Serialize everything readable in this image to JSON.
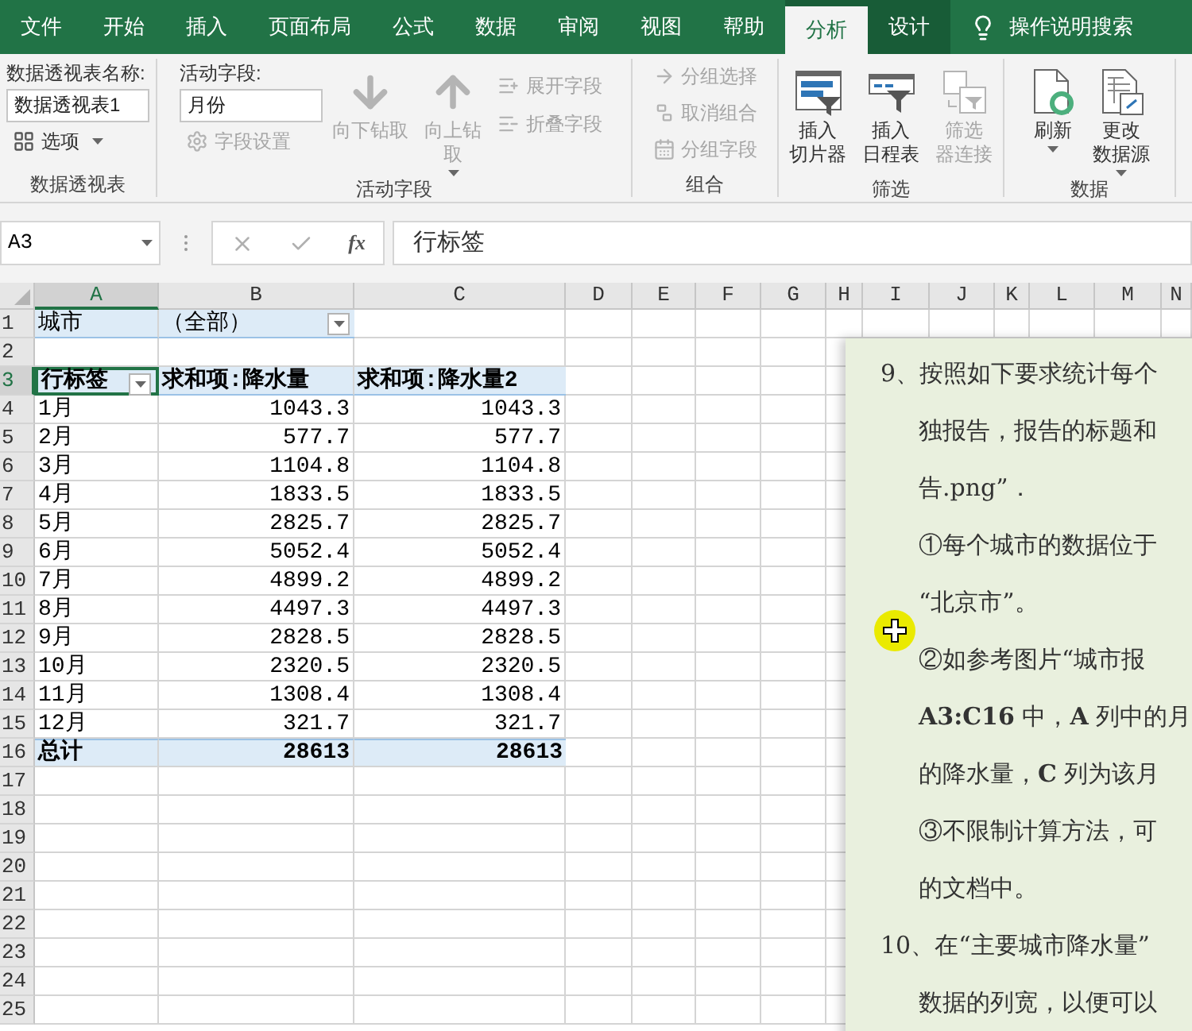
{
  "tabs": [
    {
      "label": "文件",
      "selected": false,
      "contextual": false
    },
    {
      "label": "开始",
      "selected": false,
      "contextual": false
    },
    {
      "label": "插入",
      "selected": false,
      "contextual": false
    },
    {
      "label": "页面布局",
      "selected": false,
      "contextual": false
    },
    {
      "label": "公式",
      "selected": false,
      "contextual": false
    },
    {
      "label": "数据",
      "selected": false,
      "contextual": false
    },
    {
      "label": "审阅",
      "selected": false,
      "contextual": false
    },
    {
      "label": "视图",
      "selected": false,
      "contextual": false
    },
    {
      "label": "帮助",
      "selected": false,
      "contextual": false
    },
    {
      "label": "分析",
      "selected": true,
      "contextual": true
    },
    {
      "label": "设计",
      "selected": false,
      "contextual": true
    }
  ],
  "tell_me": "操作说明搜索",
  "ribbon": {
    "groups": [
      {
        "label": "数据透视表",
        "columns": [
          [
            {
              "kind": "caption",
              "label": "数据透视表名称:"
            },
            {
              "kind": "field",
              "value": "数据透视表1"
            },
            {
              "kind": "small",
              "label": "选项",
              "disabled": false,
              "dropdown": true
            }
          ]
        ]
      },
      {
        "label": "活动字段",
        "columns": [
          [
            {
              "kind": "caption",
              "label": "活动字段:"
            },
            {
              "kind": "field",
              "value": "月份"
            },
            {
              "kind": "small",
              "label": "字段设置",
              "disabled": true,
              "dropdown": false
            }
          ],
          [
            {
              "kind": "large",
              "lines": [
                "向下钻取"
              ],
              "disabled": true,
              "dropdown": false
            }
          ],
          [
            {
              "kind": "large",
              "lines": [
                "向上钻",
                "取"
              ],
              "disabled": true,
              "dropdown": true
            }
          ],
          [
            {
              "kind": "small",
              "label": "展开字段",
              "disabled": true,
              "dropdown": false
            },
            {
              "kind": "small",
              "label": "折叠字段",
              "disabled": true,
              "dropdown": false
            }
          ]
        ]
      },
      {
        "label": "组合",
        "columns": [
          [
            {
              "kind": "small",
              "label": "分组选择",
              "disabled": true,
              "dropdown": false
            },
            {
              "kind": "small",
              "label": "取消组合",
              "disabled": true,
              "dropdown": false
            },
            {
              "kind": "small",
              "label": "分组字段",
              "disabled": true,
              "dropdown": false
            }
          ]
        ]
      },
      {
        "label": "筛选",
        "columns": [
          [
            {
              "kind": "large",
              "lines": [
                "插入",
                "切片器"
              ],
              "disabled": false,
              "dropdown": false
            }
          ],
          [
            {
              "kind": "large",
              "lines": [
                "插入",
                "日程表"
              ],
              "disabled": false,
              "dropdown": false
            }
          ],
          [
            {
              "kind": "large",
              "lines": [
                "筛选",
                "器连接"
              ],
              "disabled": true,
              "dropdown": false
            }
          ]
        ]
      },
      {
        "label": "数据",
        "columns": [
          [
            {
              "kind": "large",
              "lines": [
                "刷新"
              ],
              "disabled": false,
              "dropdown": true
            }
          ],
          [
            {
              "kind": "large",
              "lines": [
                "更改",
                "数据源"
              ],
              "disabled": false,
              "dropdown": true
            }
          ]
        ]
      }
    ]
  },
  "formula_bar": {
    "name_box": "A3",
    "fx_label": "fx",
    "value": "行标签"
  },
  "sheet": {
    "columns": [
      {
        "label": "A",
        "selected": true
      },
      {
        "label": "B",
        "selected": false
      },
      {
        "label": "C",
        "selected": false
      },
      {
        "label": "D",
        "selected": false
      },
      {
        "label": "E",
        "selected": false
      },
      {
        "label": "F",
        "selected": false
      },
      {
        "label": "G",
        "selected": false
      },
      {
        "label": "H",
        "selected": false
      },
      {
        "label": "I",
        "selected": false
      },
      {
        "label": "J",
        "selected": false
      },
      {
        "label": "K",
        "selected": false
      },
      {
        "label": "L",
        "selected": false
      },
      {
        "label": "M",
        "selected": false
      },
      {
        "label": "N",
        "selected": false
      }
    ],
    "row_numbers": [
      {
        "label": "1",
        "selected": false
      },
      {
        "label": "2",
        "selected": false
      },
      {
        "label": "3",
        "selected": true
      },
      {
        "label": "4",
        "selected": false
      },
      {
        "label": "5",
        "selected": false
      },
      {
        "label": "6",
        "selected": false
      },
      {
        "label": "7",
        "selected": false
      },
      {
        "label": "8",
        "selected": false
      },
      {
        "label": "9",
        "selected": false
      },
      {
        "label": "10",
        "selected": false
      },
      {
        "label": "11",
        "selected": false
      },
      {
        "label": "12",
        "selected": false
      },
      {
        "label": "13",
        "selected": false
      },
      {
        "label": "14",
        "selected": false
      },
      {
        "label": "15",
        "selected": false
      },
      {
        "label": "16",
        "selected": false
      },
      {
        "label": "17",
        "selected": false
      },
      {
        "label": "18",
        "selected": false
      },
      {
        "label": "19",
        "selected": false
      },
      {
        "label": "20",
        "selected": false
      },
      {
        "label": "21",
        "selected": false
      },
      {
        "label": "22",
        "selected": false
      },
      {
        "label": "23",
        "selected": false
      },
      {
        "label": "24",
        "selected": false
      },
      {
        "label": "25",
        "selected": false
      }
    ],
    "rows": [
      {
        "kind": "filter",
        "cells": [
          {
            "text": "城市",
            "selected": false
          },
          {
            "text": "（全部）",
            "selected": false
          }
        ]
      },
      {
        "kind": "empty",
        "cells": []
      },
      {
        "kind": "header",
        "cells": [
          {
            "text": "行标签",
            "selected": true
          },
          {
            "text": "求和项:降水量",
            "selected": false
          },
          {
            "text": "求和项:降水量2",
            "selected": false
          }
        ]
      },
      {
        "kind": "data",
        "cells": [
          {
            "text": "1月",
            "selected": false
          },
          {
            "text": "1043.3",
            "selected": false
          },
          {
            "text": "1043.3",
            "selected": false
          }
        ]
      },
      {
        "kind": "data",
        "cells": [
          {
            "text": "2月",
            "selected": false
          },
          {
            "text": "577.7",
            "selected": false
          },
          {
            "text": "577.7",
            "selected": false
          }
        ]
      },
      {
        "kind": "data",
        "cells": [
          {
            "text": "3月",
            "selected": false
          },
          {
            "text": "1104.8",
            "selected": false
          },
          {
            "text": "1104.8",
            "selected": false
          }
        ]
      },
      {
        "kind": "data",
        "cells": [
          {
            "text": "4月",
            "selected": false
          },
          {
            "text": "1833.5",
            "selected": false
          },
          {
            "text": "1833.5",
            "selected": false
          }
        ]
      },
      {
        "kind": "data",
        "cells": [
          {
            "text": "5月",
            "selected": false
          },
          {
            "text": "2825.7",
            "selected": false
          },
          {
            "text": "2825.7",
            "selected": false
          }
        ]
      },
      {
        "kind": "data",
        "cells": [
          {
            "text": "6月",
            "selected": false
          },
          {
            "text": "5052.4",
            "selected": false
          },
          {
            "text": "5052.4",
            "selected": false
          }
        ]
      },
      {
        "kind": "data",
        "cells": [
          {
            "text": "7月",
            "selected": false
          },
          {
            "text": "4899.2",
            "selected": false
          },
          {
            "text": "4899.2",
            "selected": false
          }
        ]
      },
      {
        "kind": "data",
        "cells": [
          {
            "text": "8月",
            "selected": false
          },
          {
            "text": "4497.3",
            "selected": false
          },
          {
            "text": "4497.3",
            "selected": false
          }
        ]
      },
      {
        "kind": "data",
        "cells": [
          {
            "text": "9月",
            "selected": false
          },
          {
            "text": "2828.5",
            "selected": false
          },
          {
            "text": "2828.5",
            "selected": false
          }
        ]
      },
      {
        "kind": "data",
        "cells": [
          {
            "text": "10月",
            "selected": false
          },
          {
            "text": "2320.5",
            "selected": false
          },
          {
            "text": "2320.5",
            "selected": false
          }
        ]
      },
      {
        "kind": "data",
        "cells": [
          {
            "text": "11月",
            "selected": false
          },
          {
            "text": "1308.4",
            "selected": false
          },
          {
            "text": "1308.4",
            "selected": false
          }
        ]
      },
      {
        "kind": "data",
        "cells": [
          {
            "text": "12月",
            "selected": false
          },
          {
            "text": "321.7",
            "selected": false
          },
          {
            "text": "321.7",
            "selected": false
          }
        ]
      },
      {
        "kind": "total",
        "cells": [
          {
            "text": "总计",
            "selected": false
          },
          {
            "text": "28613",
            "selected": false
          },
          {
            "text": "28613",
            "selected": false
          }
        ]
      }
    ]
  },
  "document": {
    "lines": [
      {
        "kind": "item",
        "text": "9、按照如下要求统计每个"
      },
      {
        "kind": "cont",
        "text": "独报告，报告的标题和"
      },
      {
        "kind": "cont",
        "text": "告.png”．"
      },
      {
        "kind": "cont",
        "text": "①每个城市的数据位于"
      },
      {
        "kind": "cont",
        "text": "“北京市”。"
      },
      {
        "kind": "cont",
        "text": "②如参考图片“城市报"
      },
      {
        "kind": "cont",
        "text": "**A3:C16** 中，**A** 列中的月"
      },
      {
        "kind": "cont",
        "text": "的降水量，**C** 列为该月"
      },
      {
        "kind": "cont",
        "text": "③不限制计算方法，可"
      },
      {
        "kind": "cont",
        "text": "的文档中。"
      },
      {
        "kind": "item",
        "text": "10、在“主要城市降水量”"
      },
      {
        "kind": "cont",
        "text": "数据的列宽，以便可以"
      }
    ]
  }
}
